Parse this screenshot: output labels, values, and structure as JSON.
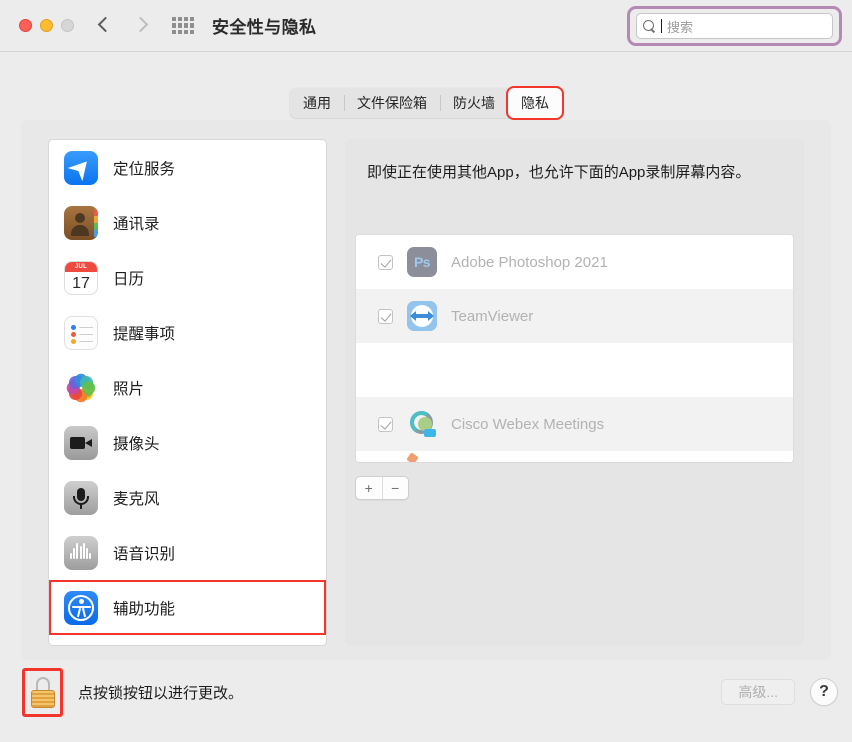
{
  "window": {
    "title": "安全性与隐私",
    "traffic_lights": [
      "close",
      "minimize",
      "zoom"
    ],
    "nav": {
      "back": "back-chevron",
      "forward": "forward-chevron",
      "grid": "all-preferences-grid"
    }
  },
  "search": {
    "placeholder": "搜索",
    "value": "",
    "highlight_color": "#b48ab4"
  },
  "tabs": [
    {
      "label": "通用",
      "active": false,
      "highlighted": false
    },
    {
      "label": "文件保险箱",
      "active": false,
      "highlighted": false
    },
    {
      "label": "防火墙",
      "active": false,
      "highlighted": false
    },
    {
      "label": "隐私",
      "active": true,
      "highlighted": true
    }
  ],
  "sidebar": {
    "items": [
      {
        "label": "定位服务",
        "icon": "location-services-icon",
        "highlighted": false
      },
      {
        "label": "通讯录",
        "icon": "contacts-icon",
        "highlighted": false
      },
      {
        "label": "日历",
        "icon": "calendar-icon",
        "highlighted": false,
        "icon_month": "JUL",
        "icon_day": "17"
      },
      {
        "label": "提醒事项",
        "icon": "reminders-icon",
        "highlighted": false
      },
      {
        "label": "照片",
        "icon": "photos-icon",
        "highlighted": false
      },
      {
        "label": "摄像头",
        "icon": "camera-icon",
        "highlighted": false
      },
      {
        "label": "麦克风",
        "icon": "microphone-icon",
        "highlighted": false
      },
      {
        "label": "语音识别",
        "icon": "speech-recognition-icon",
        "highlighted": false
      },
      {
        "label": "辅助功能",
        "icon": "accessibility-icon",
        "highlighted": true
      }
    ]
  },
  "main": {
    "description": "即使正在使用其他App，也允许下面的App录制屏幕内容。",
    "apps": [
      {
        "name": "Adobe Photoshop 2021",
        "checked": true,
        "icon": "photoshop-icon",
        "icon_text": "Ps"
      },
      {
        "name": "TeamViewer",
        "checked": true,
        "icon": "teamviewer-icon"
      },
      {
        "name": "",
        "checked": false,
        "icon": ""
      },
      {
        "name": "Cisco Webex Meetings",
        "checked": true,
        "icon": "cisco-webex-icon"
      }
    ],
    "add_label": "+",
    "remove_label": "−"
  },
  "bottom": {
    "lock_state": "locked",
    "lock_message": "点按锁按钮以进行更改。",
    "advanced_label": "高级...",
    "help_label": "?",
    "highlight_color": "#f4352b"
  }
}
